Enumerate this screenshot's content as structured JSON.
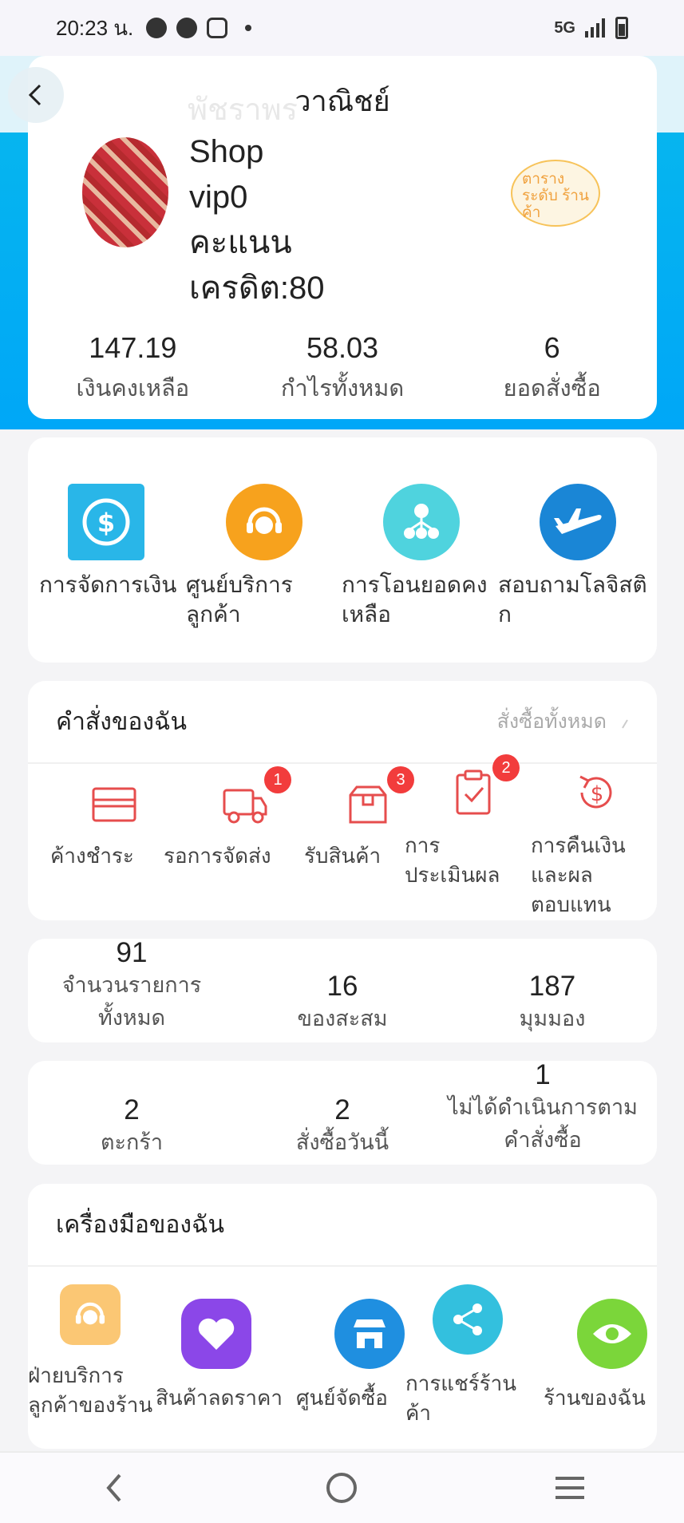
{
  "status_bar": {
    "time": "20:23 น.",
    "network": "5G"
  },
  "header": {
    "title": "วาณิชย์",
    "watermark": "พัชราพร",
    "shop_name": "Shop",
    "vip": "vip0",
    "points_label": "คะแนน",
    "credit": "เครดิต:80",
    "tier_badge": "ตาราง ระดับ ร้านค้า"
  },
  "stats": [
    {
      "value": "147.19",
      "label": "เงินคงเหลือ"
    },
    {
      "value": "58.03",
      "label": "กำไรทั้งหมด"
    },
    {
      "value": "6",
      "label": "ยอดสั่งซื้อ"
    }
  ],
  "quick_actions": [
    {
      "label": "การจัดการเงิน",
      "icon": "money-cycle-icon",
      "color": "#29b6e8"
    },
    {
      "label": "ศูนย์บริการลูกค้า",
      "icon": "headset-icon",
      "color": "#f7a21d"
    },
    {
      "label": "การโอนยอดคงเหลือ",
      "icon": "transfer-icon",
      "color": "#4fd3de"
    },
    {
      "label": "สอบถามโลจิสติก",
      "icon": "airplane-icon",
      "color": "#1a86d6"
    }
  ],
  "orders": {
    "title": "คำสั่งของฉัน",
    "more": "สั่งซื้อทั้งหมด",
    "items": [
      {
        "label": "ค้างชำระ",
        "icon": "card-icon",
        "badge": ""
      },
      {
        "label": "รอการจัดส่ง",
        "icon": "truck-icon",
        "badge": "1"
      },
      {
        "label": "รับสินค้า",
        "icon": "box-icon",
        "badge": "3"
      },
      {
        "label": "การประเมินผล",
        "icon": "clipboard-icon",
        "badge": "2"
      },
      {
        "label": "การคืนเงินและผลตอบแทน",
        "icon": "refund-icon",
        "badge": ""
      }
    ]
  },
  "counts_1": [
    {
      "value": "91",
      "label": "จำนวนรายการทั้งหมด"
    },
    {
      "value": "16",
      "label": "ของสะสม"
    },
    {
      "value": "187",
      "label": "มุมมอง"
    }
  ],
  "counts_2": [
    {
      "value": "2",
      "label": "ตะกร้า"
    },
    {
      "value": "2",
      "label": "สั่งซื้อวันนี้"
    },
    {
      "value": "1",
      "label": "ไม่ได้ดำเนินการตามคำสั่งซื้อ"
    }
  ],
  "tools": {
    "title": "เครื่องมือของฉัน",
    "items": [
      {
        "label": "ฝ่ายบริการลูกค้าของร้าน",
        "icon": "headset-icon",
        "color": "#fbc774"
      },
      {
        "label": "สินค้าลดราคา",
        "icon": "heart-icon",
        "color": "#8b47e8"
      },
      {
        "label": "ศูนย์จัดซื้อ",
        "icon": "store-icon",
        "color": "#1f8fe0"
      },
      {
        "label": "การแชร์ร้านค้า",
        "icon": "share-icon",
        "color": "#33c0de"
      },
      {
        "label": "ร้านของฉัน",
        "icon": "eye-icon",
        "color": "#7bd63a"
      }
    ]
  }
}
